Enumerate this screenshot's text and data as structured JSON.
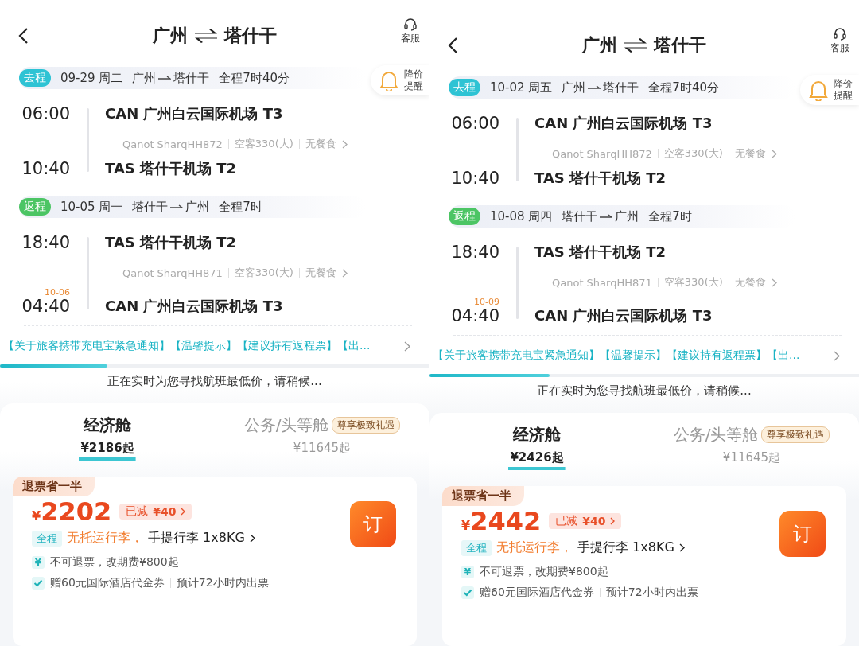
{
  "panels": [
    {
      "header": {
        "from": "广州",
        "to": "塔什干",
        "service": "客服"
      },
      "alert": "降价提醒",
      "segments": [
        {
          "tag": "去程",
          "color": "#2ec3d4",
          "date": "09-29 周二",
          "route_from": "广州",
          "route_to": "塔什干",
          "duration": "全程7时40分",
          "depart": {
            "time": "06:00",
            "airport": "CAN 广州白云国际机场 T3"
          },
          "info": [
            "Qanot SharqHH872",
            "空客330(大)",
            "无餐食"
          ],
          "arrive": {
            "time": "10:40",
            "airport": "TAS 塔什干机场 T2"
          }
        },
        {
          "tag": "返程",
          "color": "#4cc564",
          "date": "10-05 周一",
          "route_from": "塔什干",
          "route_to": "广州",
          "duration": "全程7时",
          "depart": {
            "time": "18:40",
            "airport": "TAS 塔什干机场 T2"
          },
          "info": [
            "Qanot SharqHH871",
            "空客330(大)",
            "无餐食"
          ],
          "arrive": {
            "time": "04:40",
            "day_note": "10-06",
            "airport": "CAN 广州白云国际机场 T3"
          }
        }
      ],
      "notice": "【关于旅客携带充电宝紧急通知】【温馨提示】【建议持有返程票】【出...",
      "progress": {
        "level": 0.25
      },
      "loading": "正在实时为您寻找航班最低价，请稍候...",
      "cabins": [
        {
          "name": "经济舱",
          "price": "¥2186起",
          "selected": true
        },
        {
          "name": "公务/头等舱",
          "price": "¥11645起",
          "badge": "尊享极致礼遇",
          "selected": false
        }
      ],
      "ticket": {
        "tag": "退票省一半",
        "currency": "¥",
        "price": "2202",
        "discount_label": "已减",
        "discount": "¥40",
        "scope": "全程",
        "baggage_none": "无托运行李，",
        "baggage_carry": "手提行李 1x8KG",
        "book": "订",
        "perks": [
          {
            "kind": "fee",
            "icon": "¥",
            "texts": [
              "不可退票，改期费¥800起"
            ]
          },
          {
            "kind": "check",
            "texts": [
              "赠60元国际酒店代金券",
              "预计72小时内出票"
            ]
          }
        ]
      }
    },
    {
      "header": {
        "from": "广州",
        "to": "塔什干",
        "service": "客服"
      },
      "alert": "降价提醒",
      "segments": [
        {
          "tag": "去程",
          "color": "#2ec3d4",
          "date": "10-02 周五",
          "route_from": "广州",
          "route_to": "塔什干",
          "duration": "全程7时40分",
          "depart": {
            "time": "06:00",
            "airport": "CAN 广州白云国际机场 T3"
          },
          "info": [
            "Qanot SharqHH872",
            "空客330(大)",
            "无餐食"
          ],
          "arrive": {
            "time": "10:40",
            "airport": "TAS 塔什干机场 T2"
          }
        },
        {
          "tag": "返程",
          "color": "#4cc564",
          "date": "10-08 周四",
          "route_from": "塔什干",
          "route_to": "广州",
          "duration": "全程7时",
          "depart": {
            "time": "18:40",
            "airport": "TAS 塔什干机场 T2"
          },
          "info": [
            "Qanot SharqHH871",
            "空客330(大)",
            "无餐食"
          ],
          "arrive": {
            "time": "04:40",
            "day_note": "10-09",
            "airport": "CAN 广州白云国际机场 T3"
          }
        }
      ],
      "notice": "【关于旅客携带充电宝紧急通知】【温馨提示】【建议持有返程票】【出...",
      "progress": {
        "level": 0.28
      },
      "loading": "正在实时为您寻找航班最低价，请稍候...",
      "cabins": [
        {
          "name": "经济舱",
          "price": "¥2426起",
          "selected": true
        },
        {
          "name": "公务/头等舱",
          "price": "¥11645起",
          "badge": "尊享极致礼遇",
          "selected": false
        }
      ],
      "ticket": {
        "tag": "退票省一半",
        "currency": "¥",
        "price": "2442",
        "discount_label": "已减",
        "discount": "¥40",
        "scope": "全程",
        "baggage_none": "无托运行李，",
        "baggage_carry": "手提行李 1x8KG",
        "book": "订",
        "perks": [
          {
            "kind": "fee",
            "icon": "¥",
            "texts": [
              "不可退票，改期费¥800起"
            ]
          },
          {
            "kind": "check",
            "texts": [
              "赠60元国际酒店代金券",
              "预计72小时内出票"
            ]
          }
        ]
      }
    }
  ]
}
